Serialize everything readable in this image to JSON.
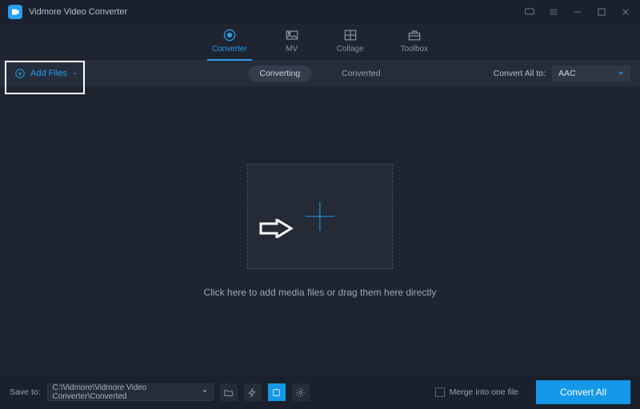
{
  "app": {
    "title": "Vidmore Video Converter"
  },
  "tabs": {
    "converter": "Converter",
    "mv": "MV",
    "collage": "Collage",
    "toolbox": "Toolbox"
  },
  "toolbar": {
    "add_files": "Add Files",
    "subtab_converting": "Converting",
    "subtab_converted": "Converted",
    "convert_all_to": "Convert All to:",
    "format": "AAC"
  },
  "main": {
    "hint": "Click here to add media files or drag them here directly"
  },
  "bottom": {
    "save_to": "Save to:",
    "path": "C:\\Vidmore\\Vidmore Video Converter\\Converted",
    "merge": "Merge into one file",
    "convert_all": "Convert All"
  }
}
